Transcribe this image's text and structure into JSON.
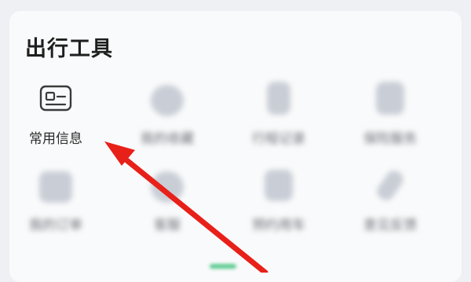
{
  "section": {
    "title": "出行工具"
  },
  "tools": [
    {
      "label": "常用信息",
      "icon": "id-card-icon"
    },
    {
      "label": "我的收藏",
      "icon": "blurred-icon"
    },
    {
      "label": "行程记录",
      "icon": "blurred-icon"
    },
    {
      "label": "保险服务",
      "icon": "blurred-icon"
    },
    {
      "label": "我的订单",
      "icon": "blurred-icon"
    },
    {
      "label": "客服",
      "icon": "blurred-icon"
    },
    {
      "label": "预约用车",
      "icon": "blurred-icon"
    },
    {
      "label": "意见反馈",
      "icon": "blurred-icon"
    }
  ],
  "colors": {
    "arrow": "#e8201a",
    "page_indicator": "#3cc27a"
  }
}
